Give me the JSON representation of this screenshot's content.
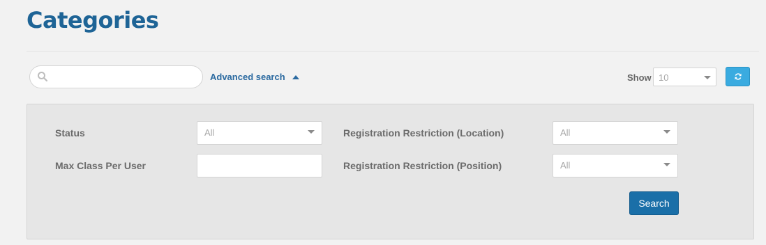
{
  "page": {
    "title": "Categories"
  },
  "toolbar": {
    "search_placeholder": "",
    "advanced_search_label": "Advanced search",
    "show_label": "Show",
    "show_value": "10"
  },
  "advanced": {
    "status_label": "Status",
    "status_value": "All",
    "max_class_label": "Max Class Per User",
    "max_class_value": "",
    "location_label": "Registration Restriction (Location)",
    "location_value": "All",
    "position_label": "Registration Restriction (Position)",
    "position_value": "All",
    "search_button": "Search"
  },
  "colors": {
    "title": "#1e6496",
    "link": "#2b6aa0",
    "refresh_button": "#3aabe0",
    "search_button": "#1a6fa8",
    "panel": "#e6e6e6"
  },
  "icons": {
    "search": "search-icon",
    "advanced_toggle": "caret-up-icon",
    "dropdown": "chevron-down-icon",
    "refresh": "refresh-icon"
  }
}
